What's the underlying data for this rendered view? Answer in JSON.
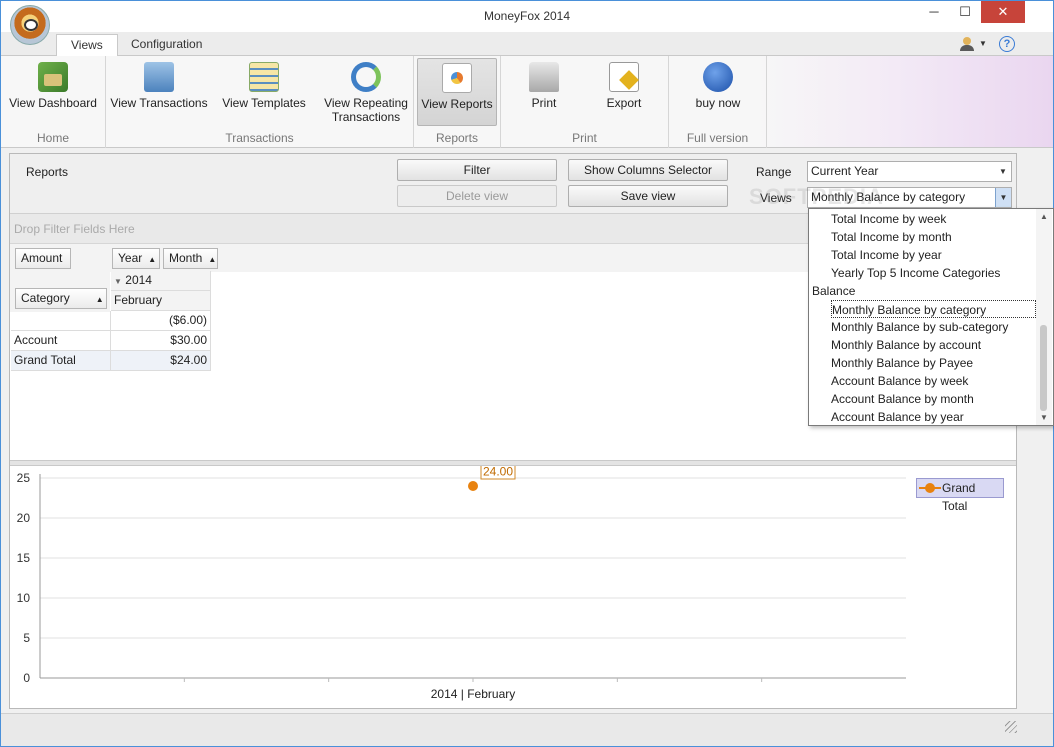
{
  "window": {
    "title": "MoneyFox 2014",
    "min": "─",
    "max": "☐",
    "close": "✕"
  },
  "tabs": [
    {
      "label": "Views"
    },
    {
      "label": "Configuration"
    }
  ],
  "header_icons": {
    "help": "?",
    "caret": "▼"
  },
  "ribbon": {
    "groups": [
      {
        "label": "Home",
        "buttons": [
          {
            "label": "View Dashboard",
            "icon": "dashboard-icon"
          }
        ]
      },
      {
        "label": "Transactions",
        "buttons": [
          {
            "label": "View Transactions",
            "icon": "transactions-icon"
          },
          {
            "label": "View Templates",
            "icon": "templates-icon"
          },
          {
            "label_line1": "View Repeating",
            "label_line2": "Transactions",
            "icon": "repeating-icon"
          }
        ]
      },
      {
        "label": "Reports",
        "buttons": [
          {
            "label": "View Reports",
            "icon": "reports-icon",
            "selected": true
          }
        ]
      },
      {
        "label": "Print",
        "buttons": [
          {
            "label": "Print",
            "icon": "printer-icon"
          },
          {
            "label": "Export",
            "icon": "export-icon"
          }
        ]
      },
      {
        "label": "Full version",
        "buttons": [
          {
            "label": "buy now",
            "icon": "cart-icon"
          }
        ]
      }
    ]
  },
  "toolbar": {
    "title": "Reports",
    "filter": "Filter",
    "delete_view": "Delete view",
    "show_columns": "Show Columns Selector",
    "save_view": "Save view",
    "range_label": "Range",
    "range_value": "Current Year",
    "views_label": "Views",
    "views_value": "Monthly Balance by category"
  },
  "pivot": {
    "drop_filter": "Drop Filter Fields Here",
    "data_field": "Amount",
    "column_fields": [
      "Year",
      "Month"
    ],
    "row_field": "Category",
    "year_value": "2014",
    "month_value": "February",
    "rows": [
      {
        "label": "",
        "value": "($6.00)"
      },
      {
        "label": "Account",
        "value": "$30.00"
      },
      {
        "label": "Grand Total",
        "value": "$24.00"
      }
    ]
  },
  "views_dropdown": {
    "items": [
      {
        "label": "Total Income by week",
        "type": "sub"
      },
      {
        "label": "Total Income by month",
        "type": "sub"
      },
      {
        "label": "Total Income by year",
        "type": "sub"
      },
      {
        "label": "Yearly Top 5 Income Categories",
        "type": "sub"
      },
      {
        "label": "Balance",
        "type": "group"
      },
      {
        "label": "Monthly Balance by category",
        "type": "sub",
        "selected": true
      },
      {
        "label": "Monthly Balance by sub-category",
        "type": "sub"
      },
      {
        "label": "Monthly Balance by account",
        "type": "sub"
      },
      {
        "label": "Monthly Balance by Payee",
        "type": "sub"
      },
      {
        "label": "Account Balance by week",
        "type": "sub"
      },
      {
        "label": "Account Balance by month",
        "type": "sub"
      },
      {
        "label": "Account Balance by year",
        "type": "sub"
      }
    ]
  },
  "watermark": "SOFTPEDIA",
  "chart_data": {
    "type": "line",
    "categories": [
      "2014 | February"
    ],
    "series": [
      {
        "name": "Grand Total",
        "values": [
          24.0
        ],
        "data_labels": [
          "24.00"
        ],
        "color": "#e8820f"
      }
    ],
    "ylim": [
      0,
      25
    ],
    "yticks": [
      0,
      5,
      10,
      15,
      20,
      25
    ],
    "grid": true,
    "legend": "top-right"
  }
}
